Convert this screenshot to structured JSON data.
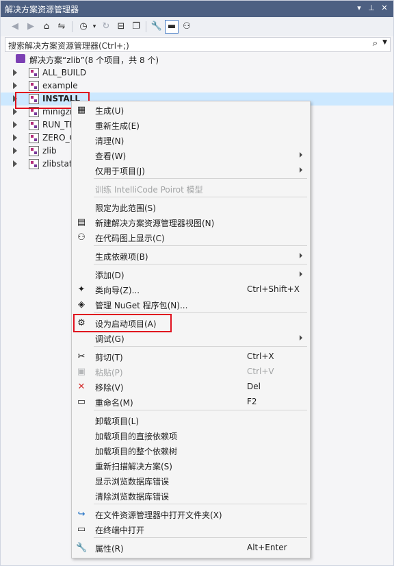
{
  "window": {
    "title": "解决方案资源管理器",
    "pin_glyph": "▾",
    "pin2_glyph": "⊥",
    "close_glyph": "✕"
  },
  "search": {
    "placeholder": "搜索解决方案资源管理器(Ctrl+;)",
    "icon_glyph": "⌕",
    "dropdown_glyph": "▼"
  },
  "tree": {
    "solution": "解决方案“zlib”(8 个项目，共 8 个)",
    "projects": [
      {
        "label": "ALL_BUILD"
      },
      {
        "label": "example"
      },
      {
        "label": "INSTALL"
      },
      {
        "label": "minigzi"
      },
      {
        "label": "RUN_TE"
      },
      {
        "label": "ZERO_C"
      },
      {
        "label": "zlib"
      },
      {
        "label": "zlibstat"
      }
    ]
  },
  "context_menu": {
    "items": [
      {
        "label": "生成(U)",
        "icon": "build-icon",
        "glyph": "▦"
      },
      {
        "label": "重新生成(E)"
      },
      {
        "label": "清理(N)"
      },
      {
        "label": "查看(W)",
        "submenu": true
      },
      {
        "label": "仅用于项目(J)",
        "submenu": true
      },
      {
        "label": "训练 IntelliCode Poirot 模型",
        "disabled": true
      },
      {
        "label": "限定为此范围(S)"
      },
      {
        "label": "新建解决方案资源管理器视图(N)",
        "icon": "new-view-icon",
        "glyph": "▤"
      },
      {
        "label": "在代码图上显示(C)",
        "icon": "code-map-icon",
        "glyph": "⚇"
      },
      {
        "label": "生成依赖项(B)",
        "submenu": true
      },
      {
        "label": "添加(D)",
        "submenu": true
      },
      {
        "label": "类向导(Z)...",
        "shortcut": "Ctrl+Shift+X",
        "icon": "class-wizard-icon",
        "glyph": "✦"
      },
      {
        "label": "管理 NuGet 程序包(N)...",
        "icon": "nuget-icon",
        "glyph": "◈"
      },
      {
        "label": "设为启动项目(A)",
        "icon": "gear-icon",
        "glyph": "⚙"
      },
      {
        "label": "调试(G)",
        "submenu": true
      },
      {
        "label": "剪切(T)",
        "shortcut": "Ctrl+X",
        "icon": "scissors-icon",
        "glyph": "✂"
      },
      {
        "label": "粘贴(P)",
        "shortcut": "Ctrl+V",
        "disabled": true,
        "icon": "paste-icon",
        "glyph": "▣"
      },
      {
        "label": "移除(V)",
        "shortcut": "Del",
        "icon": "remove-icon",
        "glyph": "✕",
        "icon_color": "#d32f2f"
      },
      {
        "label": "重命名(M)",
        "shortcut": "F2",
        "icon": "rename-icon",
        "glyph": "▭"
      },
      {
        "label": "卸载项目(L)"
      },
      {
        "label": "加载项目的直接依赖项"
      },
      {
        "label": "加载项目的整个依赖树"
      },
      {
        "label": "重新扫描解决方案(S)"
      },
      {
        "label": "显示浏览数据库错误"
      },
      {
        "label": "清除浏览数据库错误"
      },
      {
        "label": "在文件资源管理器中打开文件夹(X)",
        "icon": "open-folder-icon",
        "glyph": "↪",
        "icon_color": "#1e6fc4"
      },
      {
        "label": "在终端中打开",
        "icon": "terminal-icon",
        "glyph": "▭"
      },
      {
        "label": "属性(R)",
        "shortcut": "Alt+Enter",
        "icon": "wrench-icon",
        "glyph": "🔧"
      }
    ]
  },
  "colors": {
    "title_bar": "#4d6082",
    "selection": "#cce8ff",
    "highlight_box": "#e0101e"
  }
}
